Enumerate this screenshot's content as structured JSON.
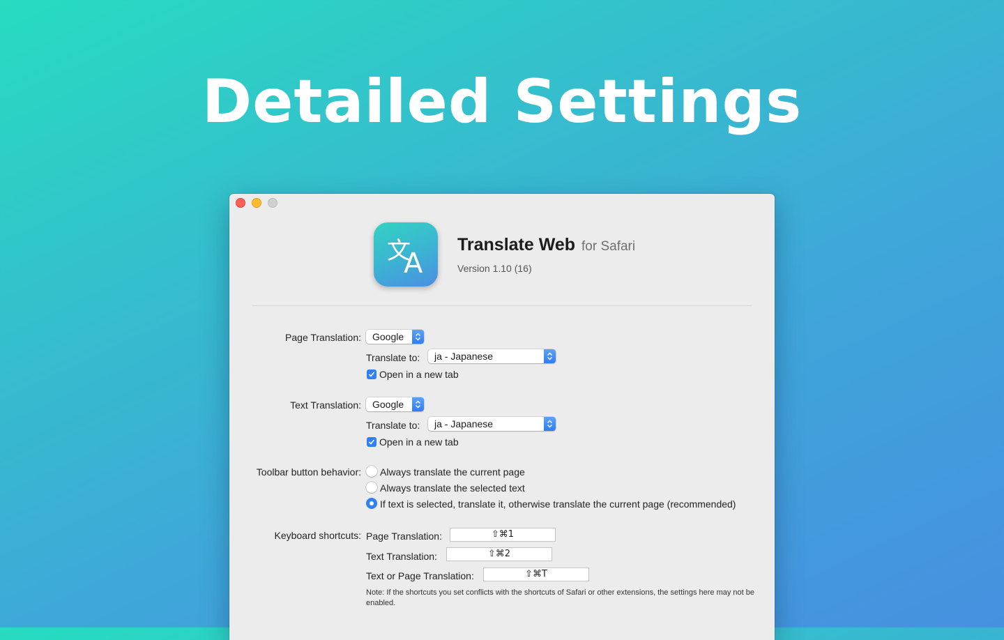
{
  "headline": "Detailed Settings",
  "app": {
    "name": "Translate Web",
    "suffix": "for Safari",
    "version": "Version 1.10 (16)",
    "icon": "translate-icon"
  },
  "page_translation": {
    "label": "Page Translation:",
    "service": "Google",
    "translate_to_label": "Translate to:",
    "translate_to_value": "ja - Japanese",
    "open_new_tab_label": "Open in a new tab",
    "open_new_tab_checked": true
  },
  "text_translation": {
    "label": "Text Translation:",
    "service": "Google",
    "translate_to_label": "Translate to:",
    "translate_to_value": "ja - Japanese",
    "open_new_tab_label": "Open in a new tab",
    "open_new_tab_checked": true
  },
  "toolbar_behavior": {
    "label": "Toolbar button behavior:",
    "options": [
      "Always translate the current page",
      "Always translate the selected text",
      "If text is selected, translate it, otherwise translate the current page (recommended)"
    ],
    "selected_index": 2
  },
  "keyboard_shortcuts": {
    "label": "Keyboard shortcuts:",
    "items": [
      {
        "label": "Page Translation:",
        "value": "⇧⌘1"
      },
      {
        "label": "Text Translation:",
        "value": "⇧⌘2"
      },
      {
        "label": "Text or Page Translation:",
        "value": "⇧⌘T"
      }
    ],
    "note": "Note: If the shortcuts you set conflicts with the shortcuts of Safari or other extensions, the settings here may not be enabled."
  },
  "colors": {
    "accent": "#2f80f3",
    "background_start": "#27dcc0",
    "background_end": "#4690e0"
  }
}
